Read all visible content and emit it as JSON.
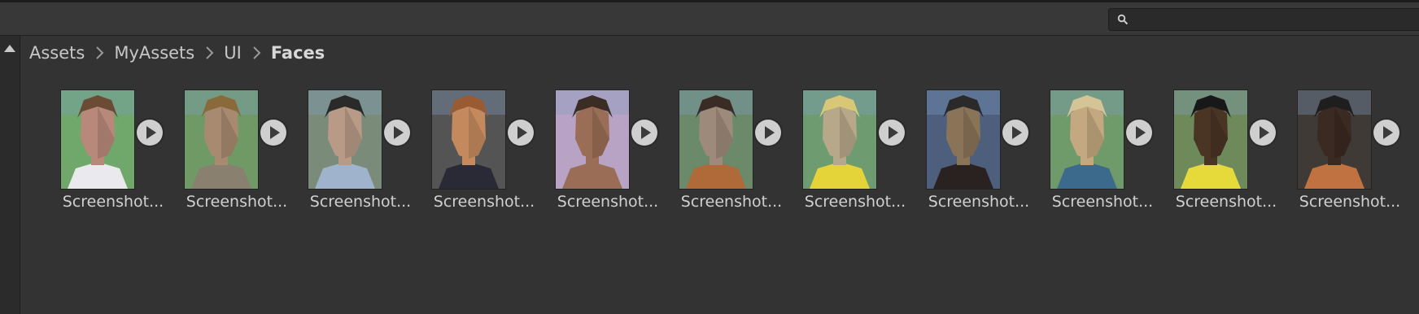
{
  "search": {
    "value": "",
    "placeholder": "",
    "icon": "search-icon"
  },
  "left_rail": {
    "icon": "collapse-up-arrow-icon"
  },
  "breadcrumb": {
    "items": [
      "Assets",
      "MyAssets",
      "UI"
    ],
    "current": "Faces",
    "separator_icon": "chevron-right-icon"
  },
  "assets": [
    {
      "label": "Screenshot...",
      "play_icon": "play-icon",
      "avatar": {
        "skin": "#b8897a",
        "hair": "#6b4a36",
        "shirt": "#e9e9ee",
        "bg": "#6fa86a"
      }
    },
    {
      "label": "Screenshot...",
      "play_icon": "play-icon",
      "avatar": {
        "skin": "#a88a70",
        "hair": "#8a6a3a",
        "shirt": "#8a8070",
        "bg": "#6f9a66"
      }
    },
    {
      "label": "Screenshot...",
      "play_icon": "play-icon",
      "avatar": {
        "skin": "#b89a86",
        "hair": "#2a2a2a",
        "shirt": "#9fb4cc",
        "bg": "#7a8b7a"
      }
    },
    {
      "label": "Screenshot...",
      "play_icon": "play-icon",
      "avatar": {
        "skin": "#c48a5e",
        "hair": "#9a5a32",
        "shirt": "#2a2a36",
        "bg": "#545454"
      }
    },
    {
      "label": "Screenshot...",
      "play_icon": "play-icon",
      "avatar": {
        "skin": "#9a6e56",
        "hair": "#3b2c26",
        "shirt": "#9a6e56",
        "bg": "#b9a3c4"
      }
    },
    {
      "label": "Screenshot...",
      "play_icon": "play-icon",
      "avatar": {
        "skin": "#9e8a7a",
        "hair": "#3a2c24",
        "shirt": "#b06a3a",
        "bg": "#6a8a6a"
      }
    },
    {
      "label": "Screenshot...",
      "play_icon": "play-icon",
      "avatar": {
        "skin": "#b8a88a",
        "hair": "#d9c778",
        "shirt": "#e4d43a",
        "bg": "#6e9c70"
      }
    },
    {
      "label": "Screenshot...",
      "play_icon": "play-icon",
      "avatar": {
        "skin": "#8a7458",
        "hair": "#2a2a2a",
        "shirt": "#2a2220",
        "bg": "#4d5f7d"
      }
    },
    {
      "label": "Screenshot...",
      "play_icon": "play-icon",
      "avatar": {
        "skin": "#c4a880",
        "hair": "#d4c496",
        "shirt": "#3c6a8c",
        "bg": "#6f9a6a"
      }
    },
    {
      "label": "Screenshot...",
      "play_icon": "play-icon",
      "avatar": {
        "skin": "#4a3424",
        "hair": "#181818",
        "shirt": "#e6d93a",
        "bg": "#6e8a5a"
      }
    },
    {
      "label": "Screenshot...",
      "play_icon": "play-icon",
      "avatar": {
        "skin": "#3a2a22",
        "hair": "#1e1e1e",
        "shirt": "#c07240",
        "bg": "#3f3a36"
      }
    }
  ]
}
